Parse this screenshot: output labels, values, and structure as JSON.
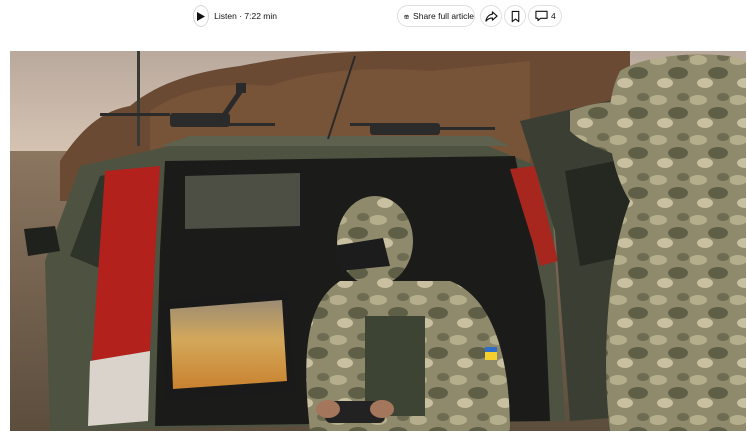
{
  "toolbar": {
    "listen_label": "Listen · 7:22 min",
    "share_label": "Share full article",
    "comment_count": "4",
    "icons": {
      "play": "play-icon",
      "gift": "gift-icon",
      "forward": "share-arrow-icon",
      "bookmark": "bookmark-icon",
      "comment": "comment-icon"
    }
  },
  "article_image": {
    "alt": "",
    "colors": {
      "sky": "#c9b9a8",
      "field": "#7d6a55",
      "vehicle": "#4e5240",
      "camo": "#8e8a6d"
    }
  }
}
